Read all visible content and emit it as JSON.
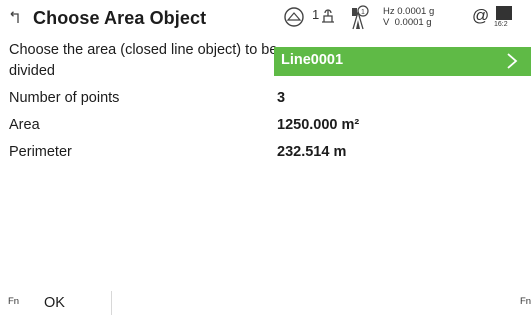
{
  "header": {
    "title": "Choose Area Object",
    "face_indicator": "1",
    "hz_reading": "Hz 0.0001 g",
    "v_reading": "V  0.0001 g",
    "at_symbol": "@",
    "time": "16:2",
    "icons": [
      "back-icon",
      "target-icon",
      "telescope-face-icon",
      "prism-icon",
      "at-icon",
      "battery-icon"
    ]
  },
  "form": {
    "area_label": "Choose the area (closed line object) to be divided",
    "area_value": "Line0001",
    "points_label": "Number of points",
    "points_value": "3",
    "area_size_label": "Area",
    "area_size_value": "1250.000 m²",
    "perimeter_label": "Perimeter",
    "perimeter_value": "232.514 m"
  },
  "footer": {
    "fn_left": "Fn",
    "ok_label": "OK",
    "fn_right": "Fn"
  },
  "colors": {
    "accent_green": "#5fba46",
    "text": "#1c1c1c",
    "background": "#ffffff"
  }
}
